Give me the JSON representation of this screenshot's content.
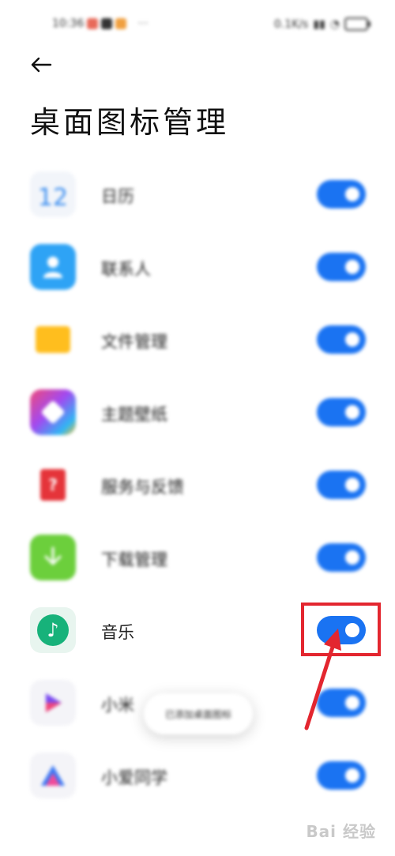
{
  "status_bar": {
    "time": "10:36",
    "more": "···",
    "network_speed": "0.1K/s",
    "battery_icon": "battery-icon"
  },
  "header": {
    "back_icon": "arrow-left-icon",
    "title": "桌面图标管理"
  },
  "items": [
    {
      "label": "日历",
      "icon": "calendar-icon",
      "icon_text": "12",
      "enabled": true
    },
    {
      "label": "联系人",
      "icon": "contacts-icon",
      "enabled": true
    },
    {
      "label": "文件管理",
      "icon": "folder-icon",
      "enabled": true
    },
    {
      "label": "主题壁纸",
      "icon": "themes-icon",
      "enabled": true
    },
    {
      "label": "服务与反馈",
      "icon": "feedback-icon",
      "icon_text": "?",
      "enabled": true
    },
    {
      "label": "下载管理",
      "icon": "download-icon",
      "enabled": true
    },
    {
      "label": "音乐",
      "icon": "music-icon",
      "enabled": true
    },
    {
      "label": "小米",
      "icon": "video-icon",
      "enabled": true
    },
    {
      "label": "小爱同学",
      "icon": "xiaoai-icon",
      "enabled": true
    }
  ],
  "toast": {
    "text": "已添加桌面图标"
  },
  "watermark": {
    "text": "Bai 经验"
  },
  "colors": {
    "toggle_on": "#1a73f2",
    "highlight": "#e3262f",
    "background": "#ffffff"
  }
}
